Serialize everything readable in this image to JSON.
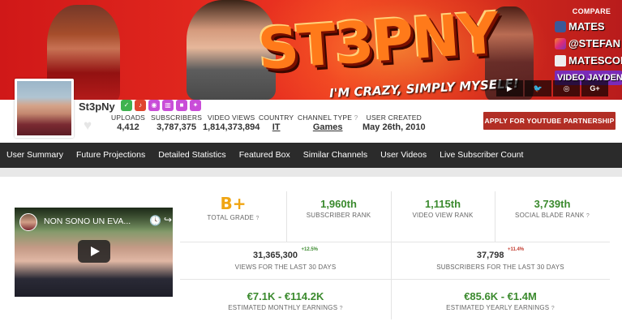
{
  "banner": {
    "logo_text": "ST3PNY",
    "tagline": "I'M CRAZY, SIMPLY MYSELF!",
    "compare_label": "COMPARE",
    "social_tags": [
      "MATES",
      "@STEFAN",
      "MATESCOLLE",
      "VIDEO JAYDEN:"
    ],
    "icons": [
      "youtube",
      "twitter",
      "instagram",
      "google-plus"
    ]
  },
  "channel": {
    "name": "St3pNy",
    "badges": [
      "verified-badge",
      "music-badge",
      "camera-badge",
      "chart-badge",
      "video-badge",
      "game-badge"
    ],
    "stats": [
      {
        "label": "UPLOADS",
        "value": "4,412"
      },
      {
        "label": "SUBSCRIBERS",
        "value": "3,787,375"
      },
      {
        "label": "VIDEO VIEWS",
        "value": "1,814,373,894"
      },
      {
        "label": "COUNTRY",
        "value": "IT"
      },
      {
        "label": "CHANNEL TYPE",
        "value": "Games"
      },
      {
        "label": "USER CREATED",
        "value": "May 26th, 2010"
      }
    ],
    "partner_button": "APPLY FOR YOUTUBE PARTNERSHIP"
  },
  "nav": {
    "items": [
      "User Summary",
      "Future Projections",
      "Detailed Statistics",
      "Featured Box",
      "Similar Channels",
      "User Videos",
      "Live Subscriber Count"
    ]
  },
  "video": {
    "title": "NON SONO UN EVA..."
  },
  "summary": {
    "grade": {
      "value": "B+",
      "label": "TOTAL GRADE"
    },
    "subscriber_rank": {
      "value": "1,960th",
      "label": "SUBSCRIBER RANK"
    },
    "video_view_rank": {
      "value": "1,115th",
      "label": "VIDEO VIEW RANK"
    },
    "social_blade_rank": {
      "value": "3,739th",
      "label": "SOCIAL BLADE RANK"
    },
    "views_30": {
      "value": "31,365,300",
      "delta": "+12.5%",
      "label": "VIEWS FOR THE LAST 30 DAYS"
    },
    "subs_30": {
      "value": "37,798",
      "delta": "+11.4%",
      "label": "SUBSCRIBERS FOR THE LAST 30 DAYS"
    },
    "monthly_earnings": {
      "value": "€7.1K - €114.2K",
      "label": "ESTIMATED MONTHLY EARNINGS"
    },
    "yearly_earnings": {
      "value": "€85.6K - €1.4M",
      "label": "ESTIMATED YEARLY EARNINGS"
    }
  },
  "colors": {
    "accent_green": "#3b8a2e",
    "grade_orange": "#f0a513",
    "button_red": "#b22e25",
    "nav_bg": "#2b2b2b"
  }
}
